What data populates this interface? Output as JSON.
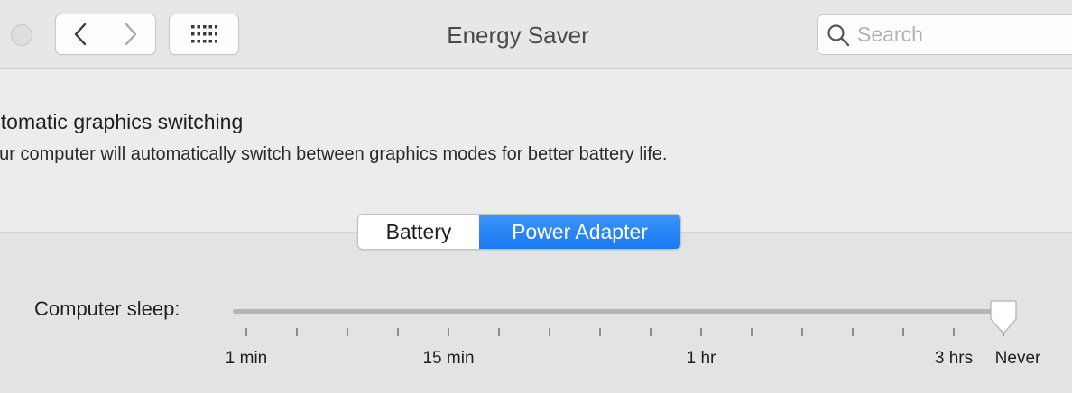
{
  "window": {
    "title": "Energy Saver"
  },
  "toolbar": {
    "back_icon": "chevron-left-icon",
    "forward_icon": "chevron-right-icon",
    "grid_icon": "show-all-grid-icon"
  },
  "search": {
    "placeholder": "Search",
    "value": "",
    "icon": "search-icon"
  },
  "graphics": {
    "title": "utomatic graphics switching",
    "description": "our computer will automatically switch between graphics modes for better battery life."
  },
  "tabs": {
    "battery": "Battery",
    "power_adapter": "Power Adapter",
    "selected": "Power Adapter"
  },
  "computer_sleep": {
    "label": "Computer sleep:",
    "value": "Never",
    "tick_labels": [
      "1 min",
      "15 min",
      "1 hr",
      "3 hrs",
      "Never"
    ]
  },
  "colors": {
    "accent": "#1a79f0"
  }
}
